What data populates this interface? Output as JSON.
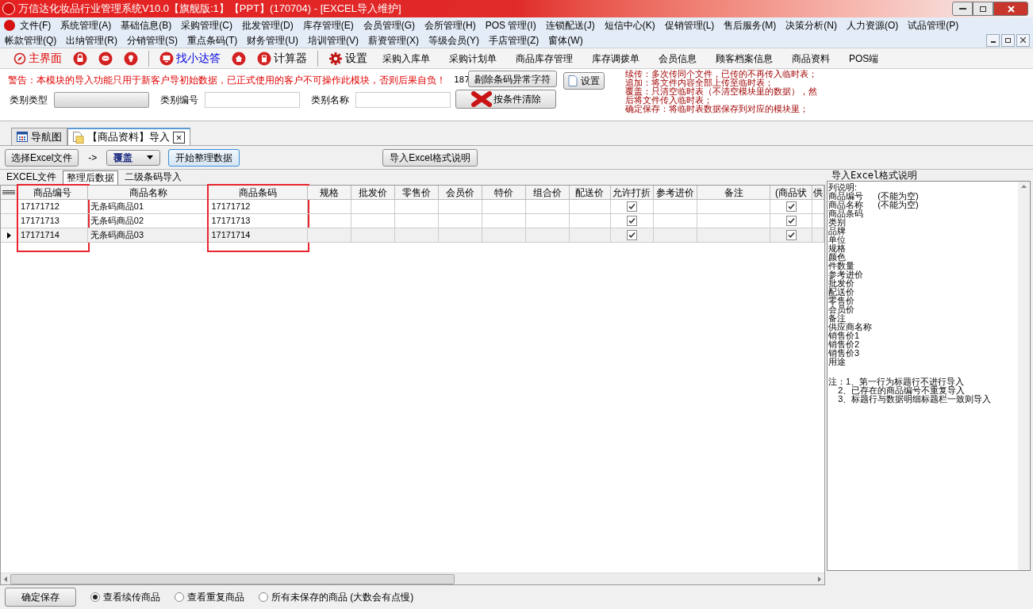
{
  "window": {
    "title": "万信达化妆品行业管理系统V10.0【旗舰版:1】【PPT】(170704) - [EXCEL导入维护]"
  },
  "menu_rows": [
    [
      "文件(F)",
      "系统管理(A)",
      "基础信息(B)",
      "采购管理(C)",
      "批发管理(D)",
      "库存管理(E)",
      "会员管理(G)",
      "会所管理(H)",
      "POS 管理(I)",
      "连锁配送(J)",
      "短信中心(K)",
      "促销管理(L)",
      "售后服务(M)",
      "决策分析(N)",
      "人力资源(O)",
      "试品管理(P)"
    ],
    [
      "帐款管理(Q)",
      "出纳管理(R)",
      "分销管理(S)",
      "重点条码(T)",
      "财务管理(U)",
      "培训管理(V)",
      "薪资管理(X)",
      "等级会员(Y)",
      "手店管理(Z)",
      "窗体(W)"
    ]
  ],
  "toolbar": [
    {
      "kind": "compass",
      "label": "主界面",
      "color": "#e00000"
    },
    {
      "kind": "lock"
    },
    {
      "kind": "chat"
    },
    {
      "kind": "bulb"
    },
    {
      "kind": "sep"
    },
    {
      "kind": "monitor",
      "label": "找小达答",
      "color": "#0000e0"
    },
    {
      "kind": "home"
    },
    {
      "kind": "calc",
      "label": "计算器"
    },
    {
      "kind": "sep"
    },
    {
      "kind": "gear",
      "label": "设置"
    },
    {
      "kind": "text",
      "label": "采购入库单"
    },
    {
      "kind": "text",
      "label": "采购计划单"
    },
    {
      "kind": "text",
      "label": "商品库存管理"
    },
    {
      "kind": "text",
      "label": "库存调拨单"
    },
    {
      "kind": "text",
      "label": "会员信息"
    },
    {
      "kind": "text",
      "label": "顾客档案信息"
    },
    {
      "kind": "text",
      "label": "商品资料"
    },
    {
      "kind": "text",
      "label": "POS端"
    }
  ],
  "import_panel": {
    "warning": "警告：本模块的导入功能只用于新客户导初始数据，已正式使用的客户不可操作此模块，否则后果自负！",
    "count": "187",
    "strip_button": "剔除条码异常字符",
    "settings_button": "设置",
    "clear_button": "按条件清除",
    "fields": [
      {
        "label": "类别类型",
        "kind": "combo"
      },
      {
        "label": "类别编号",
        "kind": "text"
      },
      {
        "label": "类别名称",
        "kind": "text"
      }
    ],
    "notes": [
      "续传：多次传同个文件，已传的不再传入临时表；",
      "追加：将文件内容全部上传至临时表；",
      "覆盖：只清空临时表（不清空模块里的数据），然",
      "后将文件传入临时表；",
      "确定保存：将临时表数据保存到对应的模块里；"
    ]
  },
  "doc_tabs": [
    {
      "label": "导航图",
      "kind": "grid",
      "selected": false
    },
    {
      "label": "【商品资料】导入",
      "kind": "doc",
      "selected": true,
      "close": "×"
    }
  ],
  "actions": {
    "choose_file": "选择Excel文件",
    "arrow": "->",
    "mode": "覆盖",
    "start": "开始整理数据",
    "format_help": "导入Excel格式说明"
  },
  "sub_tabs": [
    {
      "label": "EXCEL文件",
      "selected": false
    },
    {
      "label": "整理后数据",
      "selected": true
    },
    {
      "label": "二级条码导入",
      "selected": false
    }
  ],
  "grid": {
    "columns": [
      {
        "label": "商品编号",
        "kind": "text",
        "highlighted": true
      },
      {
        "label": "商品名称",
        "kind": "text",
        "highlighted": false
      },
      {
        "label": "商品条码",
        "kind": "text",
        "highlighted": true
      },
      {
        "label": "规格",
        "kind": "text",
        "highlighted": false
      },
      {
        "label": "批发价",
        "kind": "text",
        "highlighted": false
      },
      {
        "label": "零售价",
        "kind": "text",
        "highlighted": false
      },
      {
        "label": "会员价",
        "kind": "text",
        "highlighted": false
      },
      {
        "label": "特价",
        "kind": "text",
        "highlighted": false
      },
      {
        "label": "组合价",
        "kind": "text",
        "highlighted": false
      },
      {
        "label": "配送价",
        "kind": "text",
        "highlighted": false
      },
      {
        "label": "允许打折",
        "kind": "check",
        "highlighted": false
      },
      {
        "label": "参考进价",
        "kind": "text",
        "highlighted": false
      },
      {
        "label": "备注",
        "kind": "text",
        "highlighted": false
      },
      {
        "label": "(商品状",
        "kind": "check",
        "highlighted": false
      },
      {
        "label": "供",
        "kind": "text",
        "highlighted": false
      }
    ],
    "rows": [
      {
        "current": false,
        "cells": [
          "17171712",
          "无条码商品01",
          "17171712",
          "",
          "",
          "",
          "",
          "",
          "",
          "",
          true,
          "",
          "",
          true,
          ""
        ]
      },
      {
        "current": false,
        "cells": [
          "17171713",
          "无条码商品02",
          "17171713",
          "",
          "",
          "",
          "",
          "",
          "",
          "",
          true,
          "",
          "",
          true,
          ""
        ]
      },
      {
        "current": true,
        "cells": [
          "17171714",
          "无条码商品03",
          "17171714",
          "",
          "",
          "",
          "",
          "",
          "",
          "",
          true,
          "",
          "",
          true,
          ""
        ]
      }
    ]
  },
  "format_panel": {
    "title": "导入Excel格式说明",
    "lines": [
      "列说明:",
      "商品编号      (不能为空)",
      "商品名称      (不能为空)",
      "商品条码",
      "类别",
      "品牌",
      "单位",
      "规格",
      "颜色",
      "件数量",
      "参考进价",
      "批发价",
      "配送价",
      "零售价",
      "会员价",
      "备注",
      "供应商名称",
      "销售价1",
      "销售价2",
      "销售价3",
      "用途"
    ],
    "notes": [
      "注：1、第一行为标题行不进行导入",
      "    2、已存在的商品编号不重复导入",
      "    3、标题行与数据明细标题栏一致则导入"
    ]
  },
  "bottom": {
    "save": "确定保存",
    "radios": [
      {
        "label": "查看续传商品",
        "selected": true
      },
      {
        "label": "查看重复商品",
        "selected": false
      },
      {
        "label": "所有未保存的商品 (大数会有点慢)",
        "selected": false
      }
    ]
  }
}
